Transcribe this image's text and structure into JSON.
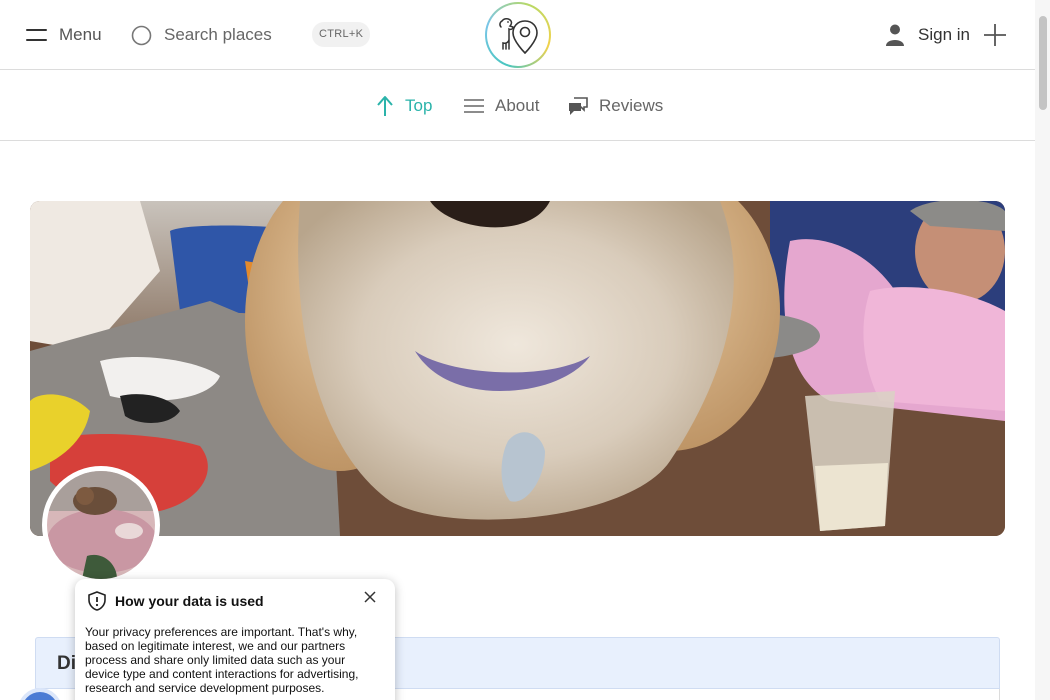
{
  "header": {
    "menu_label": "Menu",
    "search_placeholder": "Search places",
    "shortcut": "CTRL+K",
    "signin_label": "Sign in"
  },
  "tabs": [
    {
      "label": "Top",
      "icon": "arrow-up-icon",
      "active": true
    },
    {
      "label": "About",
      "icon": "lines-icon",
      "active": false
    },
    {
      "label": "Reviews",
      "icon": "chat-bubbles-icon",
      "active": false
    }
  ],
  "section": {
    "title": "Di"
  },
  "consent": {
    "title": "How your data is used",
    "body": "Your privacy preferences are important. That's why, based on legitimate interest, we and our partners process and share only limited data such as your device type and content interactions for advertising, research and service development purposes."
  },
  "colors": {
    "accent": "#2bb3aa",
    "section_bg": "#e8f0fd"
  }
}
